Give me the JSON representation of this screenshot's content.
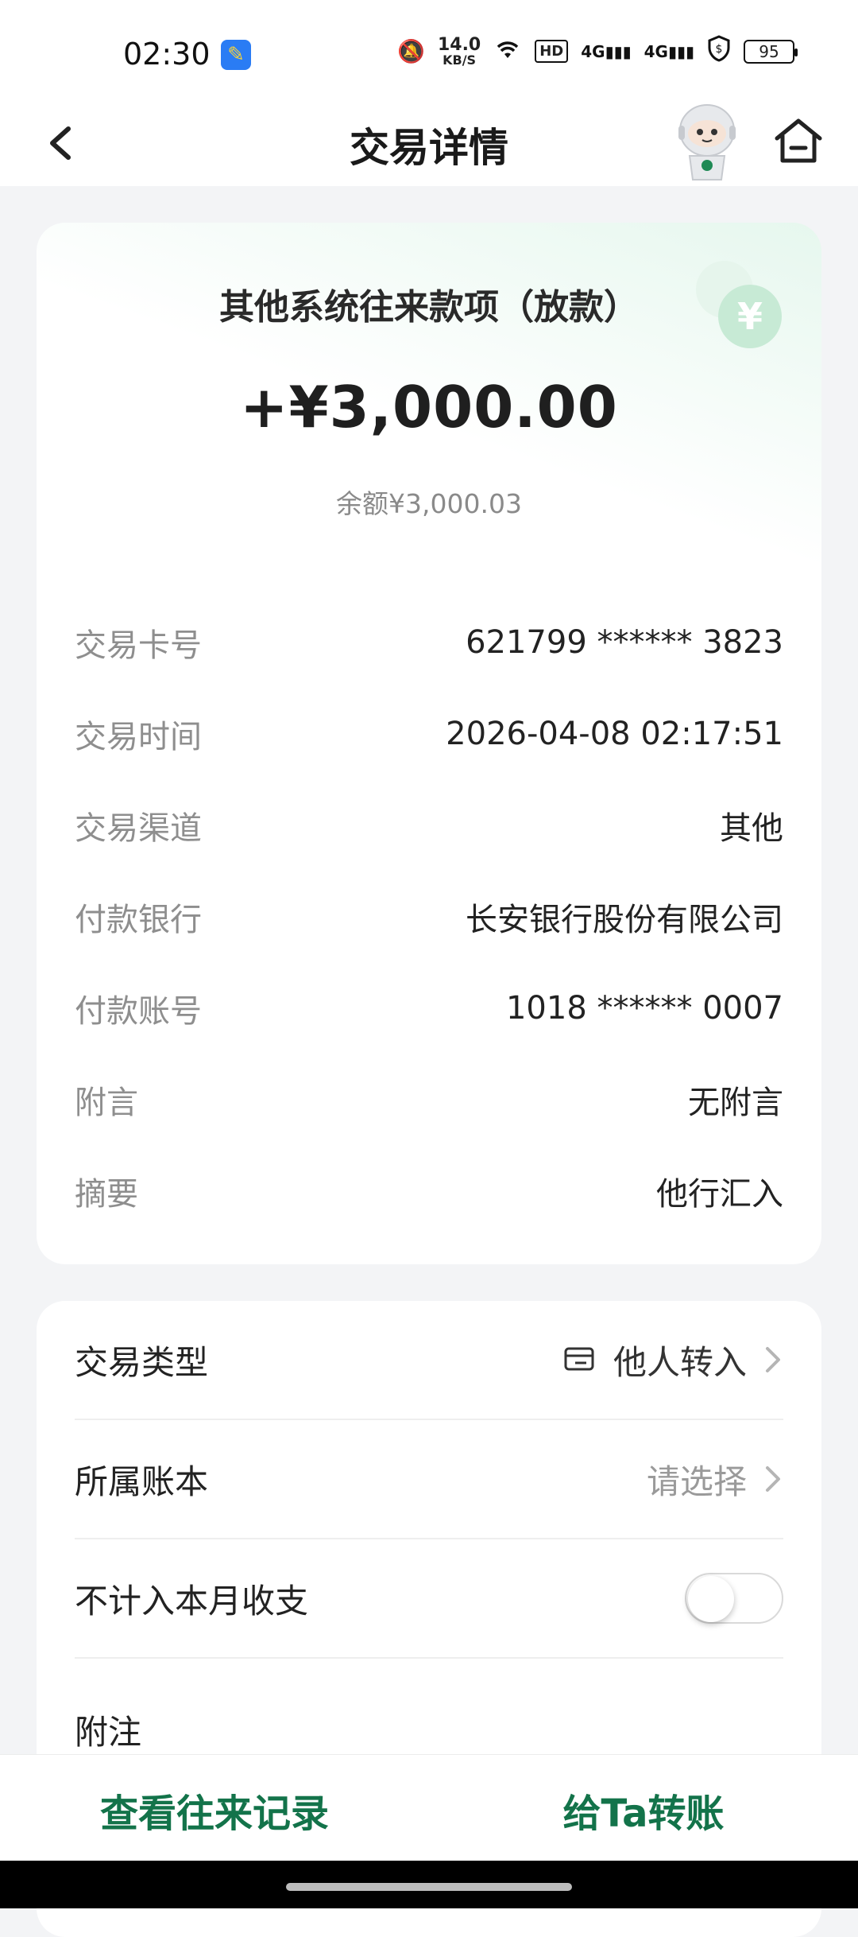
{
  "status_bar": {
    "time": "02:30",
    "net_speed_value": "14.0",
    "net_speed_unit": "KB/S",
    "hd_label": "HD",
    "signal_label_1": "4G",
    "signal_label_2": "4G",
    "battery": "95"
  },
  "nav": {
    "title": "交易详情"
  },
  "transaction": {
    "title": "其他系统往来款项（放款）",
    "amount": "+¥3,000.00",
    "balance": "余额¥3,000.03",
    "details": [
      {
        "label": "交易卡号",
        "value": "621799 ****** 3823"
      },
      {
        "label": "交易时间",
        "value": "2026-04-08 02:17:51"
      },
      {
        "label": "交易渠道",
        "value": "其他"
      },
      {
        "label": "付款银行",
        "value": "长安银行股份有限公司"
      },
      {
        "label": "付款账号",
        "value": "1018 ****** 0007"
      },
      {
        "label": "附言",
        "value": "无附言"
      },
      {
        "label": "摘要",
        "value": "他行汇入"
      }
    ]
  },
  "options": {
    "type_label": "交易类型",
    "type_value": "他人转入",
    "book_label": "所属账本",
    "book_value": "请选择",
    "exclude_label": "不计入本月收支",
    "exclude_enabled": false,
    "note_label": "附注"
  },
  "bottom_bar": {
    "history_label": "查看往来记录",
    "transfer_label": "给Ta转账"
  },
  "colors": {
    "accent_green": "#13734a",
    "coin_green": "#bfe7cf"
  }
}
